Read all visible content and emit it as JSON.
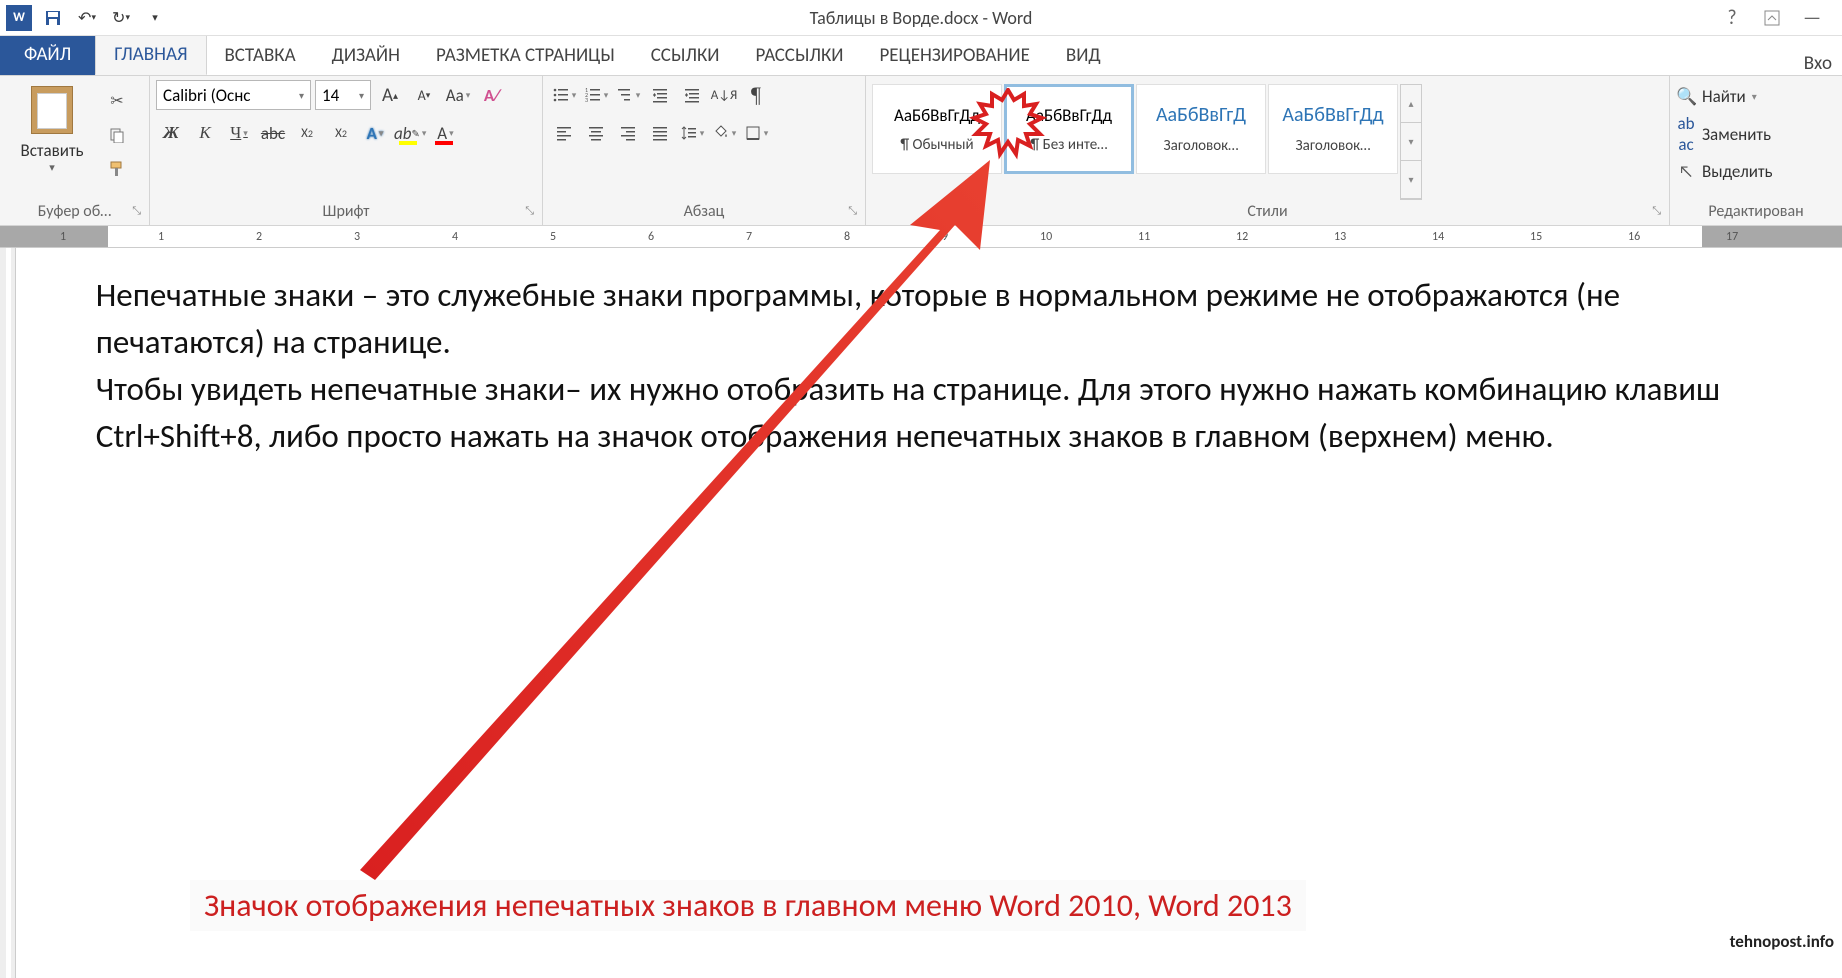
{
  "titlebar": {
    "app_badge": "W",
    "title": "Таблицы в Ворде.docx - Word"
  },
  "tabs": {
    "file": "ФАЙЛ",
    "items": [
      "ГЛАВНАЯ",
      "ВСТАВКА",
      "ДИЗАЙН",
      "РАЗМЕТКА СТРАНИЦЫ",
      "ССЫЛКИ",
      "РАССЫЛКИ",
      "РЕЦЕНЗИРОВАНИЕ",
      "ВИД"
    ],
    "active_index": 0,
    "right": "Вхо"
  },
  "ribbon": {
    "clipboard": {
      "paste": "Вставить",
      "label": "Буфер об…"
    },
    "font": {
      "name": "Calibri (Оснс",
      "size": "14",
      "label": "Шрифт",
      "bold": "Ж",
      "italic": "К",
      "underline": "Ч",
      "strike": "abc",
      "sub": "X",
      "sup": "X",
      "grow": "A",
      "shrink": "A",
      "case": "Aa",
      "clear": "#",
      "effects": "A",
      "highlight": "ab",
      "color": "A"
    },
    "paragraph": {
      "label": "Абзац",
      "pilcrow": "¶",
      "sort": "А↓",
      "sort2": "Я"
    },
    "styles": {
      "label": "Стили",
      "items": [
        {
          "sample": "АаБбВвГгДд",
          "name": "¶ Обычный",
          "blue": false
        },
        {
          "sample": "АаБбВвГгДд",
          "name": "¶ Без инте…",
          "blue": false
        },
        {
          "sample": "АаБбВвГгД",
          "name": "Заголовок…",
          "blue": true
        },
        {
          "sample": "АаБбВвГгДд",
          "name": "Заголовок…",
          "blue": true
        }
      ],
      "selected_index": 1
    },
    "editing": {
      "find": "Найти",
      "replace": "Заменить",
      "select": "Выделить",
      "label": "Редактирован"
    }
  },
  "ruler": {
    "numbers": [
      "1",
      "1",
      "2",
      "3",
      "4",
      "5",
      "6",
      "7",
      "8",
      "9",
      "10",
      "11",
      "12",
      "13",
      "14",
      "15",
      "16",
      "17"
    ]
  },
  "document": {
    "p1": "Непечатные знаки – это служебные знаки программы, которые в нормальном режиме не отображаются (не печатаются) на странице.",
    "p2": "Чтобы увидеть непечатные знаки– их нужно отобразить на странице. Для этого нужно нажать комбинацию клавиш Ctrl+Shift+8, либо просто нажать на значок отображения непечатных знаков в главном (верхнем) меню."
  },
  "annotation": {
    "caption": "Значок отображения непечатных знаков в главном меню Word 2010, Word   2013",
    "watermark": "tehnopost.info"
  }
}
